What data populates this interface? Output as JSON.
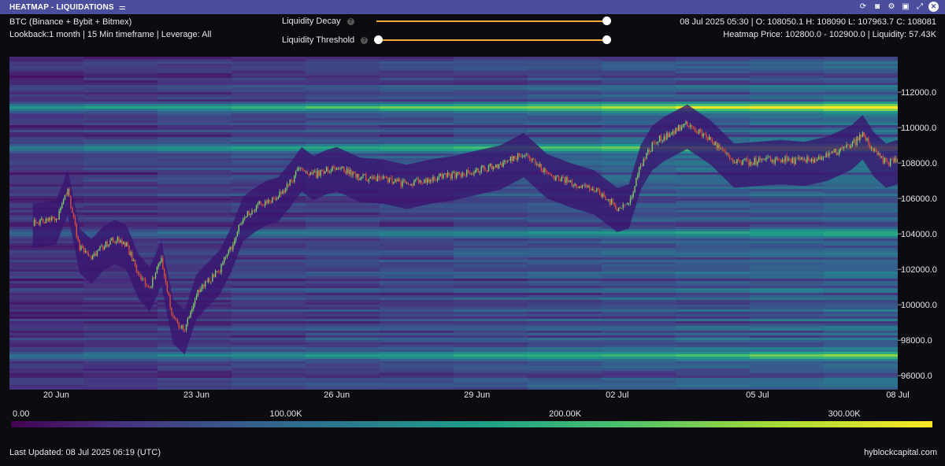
{
  "window": {
    "title": "HEATMAP - LIQUIDATIONS",
    "icons": [
      "tune-icon",
      "refresh-icon",
      "camera-icon",
      "gear-icon",
      "save-icon",
      "expand-icon",
      "close-icon"
    ]
  },
  "header": {
    "pair": "BTC (Binance + Bybit + Bitmex)",
    "lookback": "Lookback:1 month | 15 Min timeframe | Leverage: All",
    "ohlc": "08 Jul 2025 05:30 | O: 108050.1 H: 108090 L: 107963.7 C: 108081",
    "heatmap_info": "Heatmap Price: 102800.0 - 102900.0 | Liquidity: 57.43K"
  },
  "controls": {
    "decay_label": "Liquidity Decay",
    "threshold_label": "Liquidity Threshold",
    "help_glyph": "?",
    "decay_value": 1.0,
    "threshold_value": 0.0
  },
  "chart_data": {
    "type": "heatmap",
    "title": "",
    "x_ticks": [
      "20 Jun",
      "23 Jun",
      "26 Jun",
      "29 Jun",
      "02 Jul",
      "05 Jul",
      "08 Jul"
    ],
    "y_ticks": [
      "112000.0",
      "110000.0",
      "108000.0",
      "106000.0",
      "104000.0",
      "102000.0",
      "100000.0",
      "98000.0",
      "96000.0"
    ],
    "y_tick_values": [
      112000,
      110000,
      108000,
      106000,
      104000,
      102000,
      100000,
      98000,
      96000
    ],
    "ylim": [
      95300,
      114000
    ],
    "xlim": [
      "19 Jun 2025",
      "08 Jul 2025"
    ],
    "price_series": {
      "type": "candlestick",
      "points": [
        [
          "19 Jun 12:00",
          104600
        ],
        [
          "20 Jun 00:00",
          104800
        ],
        [
          "20 Jun 06:00",
          106500
        ],
        [
          "20 Jun 12:00",
          103200
        ],
        [
          "20 Jun 18:00",
          102600
        ],
        [
          "21 Jun 00:00",
          103300
        ],
        [
          "21 Jun 06:00",
          103700
        ],
        [
          "21 Jun 12:00",
          103400
        ],
        [
          "21 Jun 18:00",
          101800
        ],
        [
          "22 Jun 00:00",
          101000
        ],
        [
          "22 Jun 06:00",
          102500
        ],
        [
          "22 Jun 12:00",
          99200
        ],
        [
          "22 Jun 18:00",
          98600
        ],
        [
          "23 Jun 00:00",
          100600
        ],
        [
          "23 Jun 06:00",
          101300
        ],
        [
          "23 Jun 12:00",
          102000
        ],
        [
          "23 Jun 18:00",
          103300
        ],
        [
          "24 Jun 00:00",
          105000
        ],
        [
          "24 Jun 06:00",
          105500
        ],
        [
          "24 Jun 12:00",
          105900
        ],
        [
          "24 Jun 18:00",
          106100
        ],
        [
          "25 Jun 00:00",
          106900
        ],
        [
          "25 Jun 06:00",
          107800
        ],
        [
          "25 Jun 12:00",
          107300
        ],
        [
          "25 Jun 18:00",
          107600
        ],
        [
          "26 Jun 00:00",
          107800
        ],
        [
          "26 Jun 12:00",
          107200
        ],
        [
          "27 Jun 00:00",
          107100
        ],
        [
          "27 Jun 12:00",
          106800
        ],
        [
          "28 Jun 00:00",
          107100
        ],
        [
          "28 Jun 12:00",
          107300
        ],
        [
          "29 Jun 00:00",
          107600
        ],
        [
          "29 Jun 12:00",
          107900
        ],
        [
          "30 Jun 00:00",
          108600
        ],
        [
          "30 Jun 12:00",
          107400
        ],
        [
          "01 Jul 00:00",
          106900
        ],
        [
          "01 Jul 12:00",
          106500
        ],
        [
          "02 Jul 00:00",
          105500
        ],
        [
          "02 Jul 06:00",
          105700
        ],
        [
          "02 Jul 12:00",
          107900
        ],
        [
          "02 Jul 18:00",
          109000
        ],
        [
          "03 Jul 00:00",
          109500
        ],
        [
          "03 Jul 12:00",
          110200
        ],
        [
          "04 Jul 00:00",
          109300
        ],
        [
          "04 Jul 12:00",
          108000
        ],
        [
          "05 Jul 00:00",
          108100
        ],
        [
          "05 Jul 12:00",
          108200
        ],
        [
          "06 Jul 00:00",
          108100
        ],
        [
          "06 Jul 12:00",
          108400
        ],
        [
          "07 Jul 00:00",
          109000
        ],
        [
          "07 Jul 06:00",
          109600
        ],
        [
          "07 Jul 12:00",
          108600
        ],
        [
          "07 Jul 18:00",
          108000
        ],
        [
          "08 Jul 00:00",
          108200
        ],
        [
          "08 Jul 05:30",
          108081
        ]
      ]
    },
    "bright_bands": [
      {
        "price": 111200,
        "intensity": 0.95
      },
      {
        "price": 108900,
        "intensity": 0.85
      },
      {
        "price": 97200,
        "intensity": 0.7
      },
      {
        "price": 104100,
        "intensity": 0.55
      }
    ],
    "colorbar": {
      "ticks": [
        "0.00",
        "100.00K",
        "200.00K",
        "300.00K"
      ],
      "tick_values": [
        0,
        100000,
        200000,
        300000
      ],
      "max": 330000,
      "colors": [
        "#440154",
        "#46327e",
        "#365c8d",
        "#277f8e",
        "#1fa187",
        "#4ac16d",
        "#a0da39",
        "#fde725"
      ]
    }
  },
  "footer": {
    "updated": "Last Updated: 08 Jul 2025 06:19 (UTC)",
    "brand": "hyblockcapital.com"
  }
}
